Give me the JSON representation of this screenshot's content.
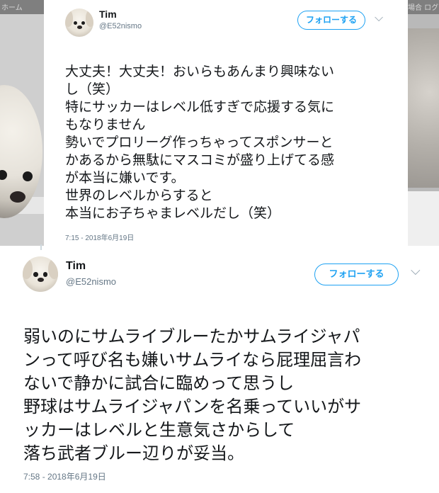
{
  "background": {
    "left_strip_text": "ホーム",
    "right_strip_text": "の場合 ログ"
  },
  "tweets": [
    {
      "name": "Tim",
      "handle": "@E52nismo",
      "follow_label": "フォローする",
      "chevron": "⌵",
      "lines": [
        "大丈夫！大丈夫！おいらもあんまり興味ない",
        "し（笑）",
        "特にサッカーはレベル低すぎで応援する気に",
        "もなりません",
        "勢いでプロリーグ作っちゃってスポンサーと",
        "かあるから無駄にマスコミが盛り上げてる感",
        "が本当に嫌いです。",
        "世界のレベルからすると",
        "本当にお子ちゃまレベルだし（笑）"
      ],
      "timestamp": "7:15 - 2018年6月19日"
    },
    {
      "name": "Tim",
      "handle": "@E52nismo",
      "follow_label": "フォローする",
      "chevron": "⌵",
      "lines": [
        "弱いのにサムライブルーたかサムライジャパ",
        "ンって呼び名も嫌いサムライなら屁理屈言わ",
        "ないで静かに試合に臨めって思うし",
        "野球はサムライジャパンを名乗っていいがサ",
        "ッカーはレベルと生意気さからして",
        "落ち武者ブルー辺りが妥当。"
      ],
      "timestamp": "7:58 - 2018年6月19日"
    }
  ],
  "colors": {
    "accent": "#1da1f2",
    "text": "#14171a",
    "muted": "#657786"
  }
}
